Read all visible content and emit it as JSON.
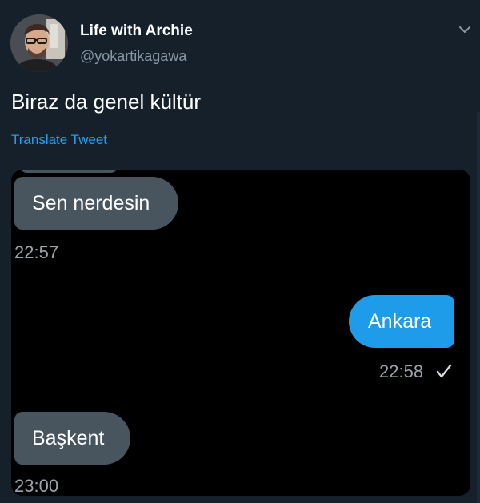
{
  "tweet": {
    "display_name": "Life with Archie",
    "handle": "@yokartikagawa",
    "text": "Biraz da genel kültür",
    "translate_label": "Translate Tweet"
  },
  "chat": {
    "messages": [
      {
        "direction": "incoming",
        "text": "Sen nerdesin",
        "time": "22:57"
      },
      {
        "direction": "outgoing",
        "text": "Ankara",
        "time": "22:58",
        "status_icon": "check-icon"
      },
      {
        "direction": "incoming",
        "text": "Başkent",
        "time": "23:00"
      }
    ]
  },
  "colors": {
    "background": "#15202b",
    "accent": "#1da1f2",
    "incoming_bubble": "#48555f",
    "outgoing_bubble": "#1e9be9",
    "secondary_text": "#8899a6"
  },
  "icons": {
    "menu": "chevron-down-icon",
    "status": "check-icon"
  }
}
